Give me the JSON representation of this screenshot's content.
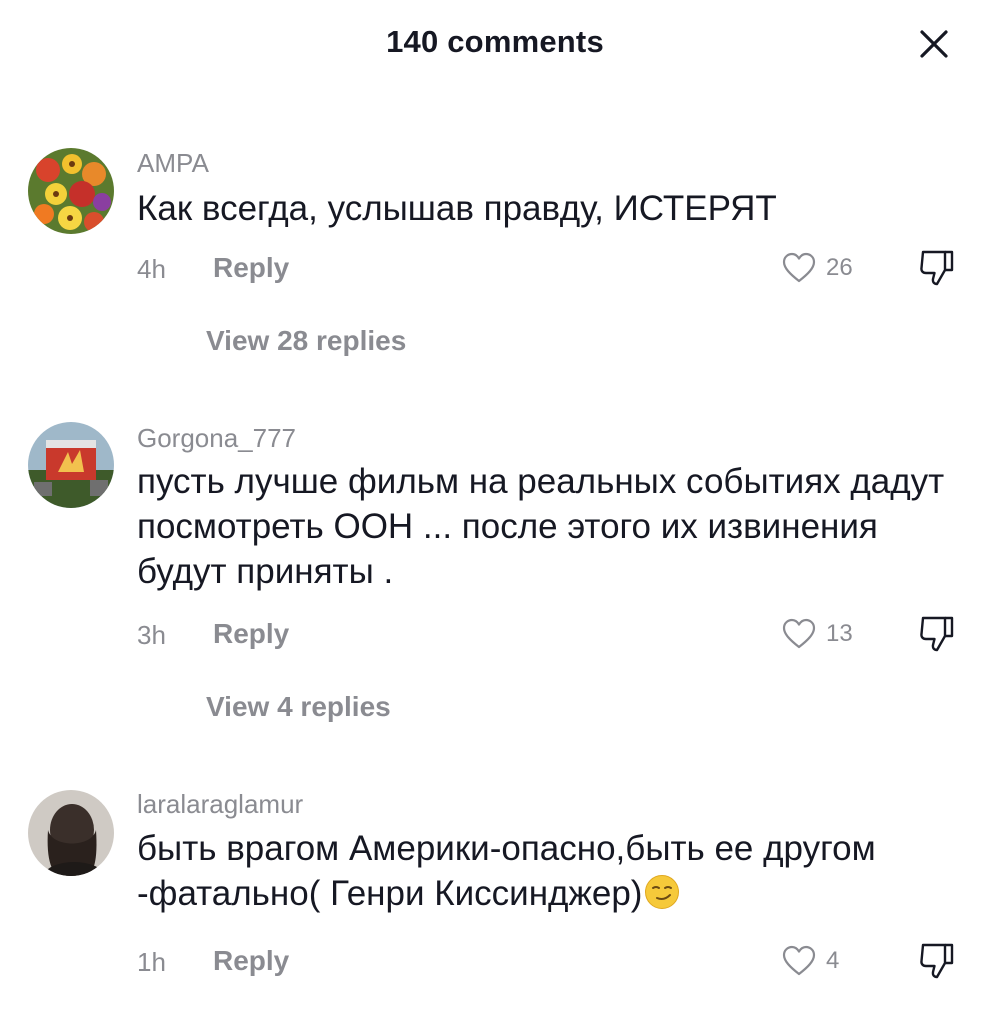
{
  "header": {
    "title": "140 comments"
  },
  "comments": [
    {
      "username": "АМРА",
      "text": "Как всегда, услышав правду, ИСТЕРЯТ",
      "time": "4h",
      "reply_label": "Reply",
      "likes": "26",
      "view_replies": "View 28 replies"
    },
    {
      "username": "Gorgona_777",
      "text": "пусть лучше фильм на реальных событиях дадут посмотреть ООН ... после этого их извинения будут приняты .",
      "time": "3h",
      "reply_label": "Reply",
      "likes": "13",
      "view_replies": "View 4 replies"
    },
    {
      "username": "laralaraglamur",
      "text": "быть врагом Америки-опасно,быть ее другом -фатально( Генри Киссинджер)",
      "emoji": "smirking-face-emoji",
      "time": "1h",
      "reply_label": "Reply",
      "likes": "4"
    }
  ],
  "icons": {
    "close": "close-icon",
    "like": "heart-outline-icon",
    "dislike": "thumbs-down-outline-icon"
  },
  "colors": {
    "text_primary": "#161823",
    "text_secondary": "#8a8b91",
    "background": "#ffffff"
  }
}
